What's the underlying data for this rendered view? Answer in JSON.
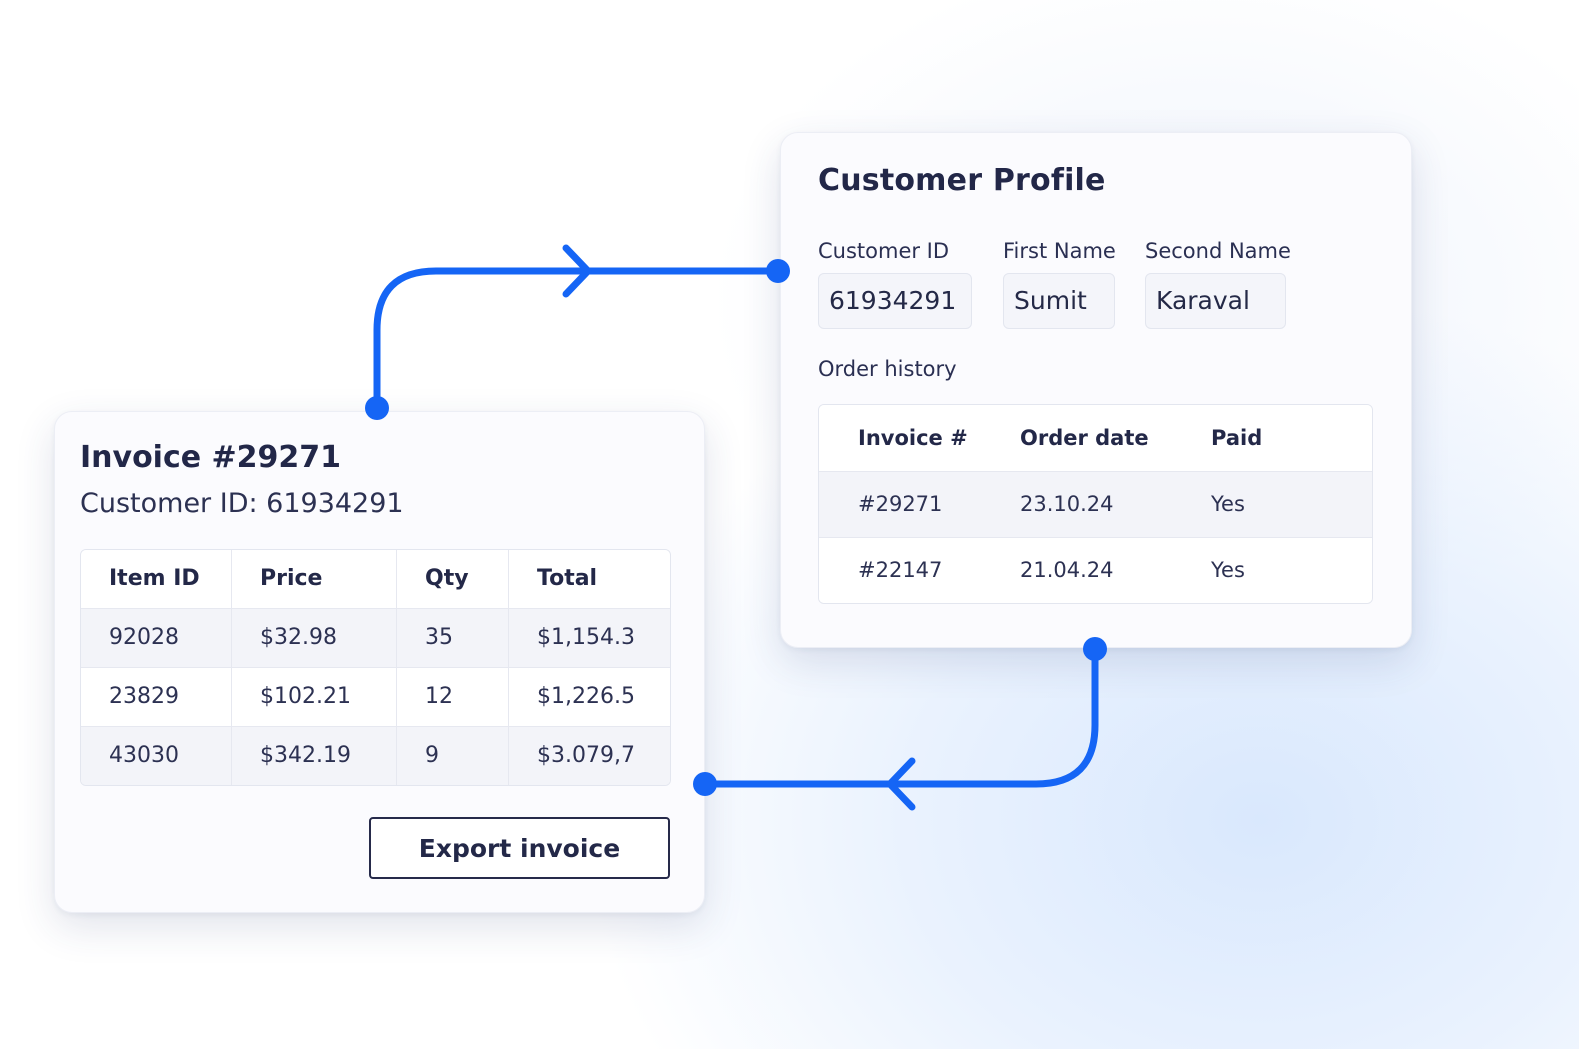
{
  "colors": {
    "connector": "#1565f5",
    "text_dark": "#222748",
    "card_bg": "#fbfbfe"
  },
  "profile": {
    "title": "Customer Profile",
    "fields": {
      "customer_id": {
        "label": "Customer ID",
        "value": "61934291"
      },
      "first_name": {
        "label": "First Name",
        "value": "Sumit"
      },
      "second_name": {
        "label": "Second Name",
        "value": "Karaval"
      }
    },
    "order_history_label": "Order history",
    "orders": {
      "headers": [
        "Invoice #",
        "Order date",
        "Paid"
      ],
      "rows": [
        [
          "#29271",
          "23.10.24",
          "Yes"
        ],
        [
          "#22147",
          "21.04.24",
          "Yes"
        ]
      ]
    }
  },
  "invoice": {
    "title": "Invoice #29271",
    "subtitle": "Customer ID: 61934291",
    "items": {
      "headers": [
        "Item ID",
        "Price",
        "Qty",
        "Total"
      ],
      "rows": [
        [
          "92028",
          "$32.98",
          "35",
          "$1,154.3"
        ],
        [
          "23829",
          "$102.21",
          "12",
          "$1,226.5"
        ],
        [
          "43030",
          "$342.19",
          "9",
          "$3.079,7"
        ]
      ]
    },
    "export_label": "Export invoice"
  }
}
